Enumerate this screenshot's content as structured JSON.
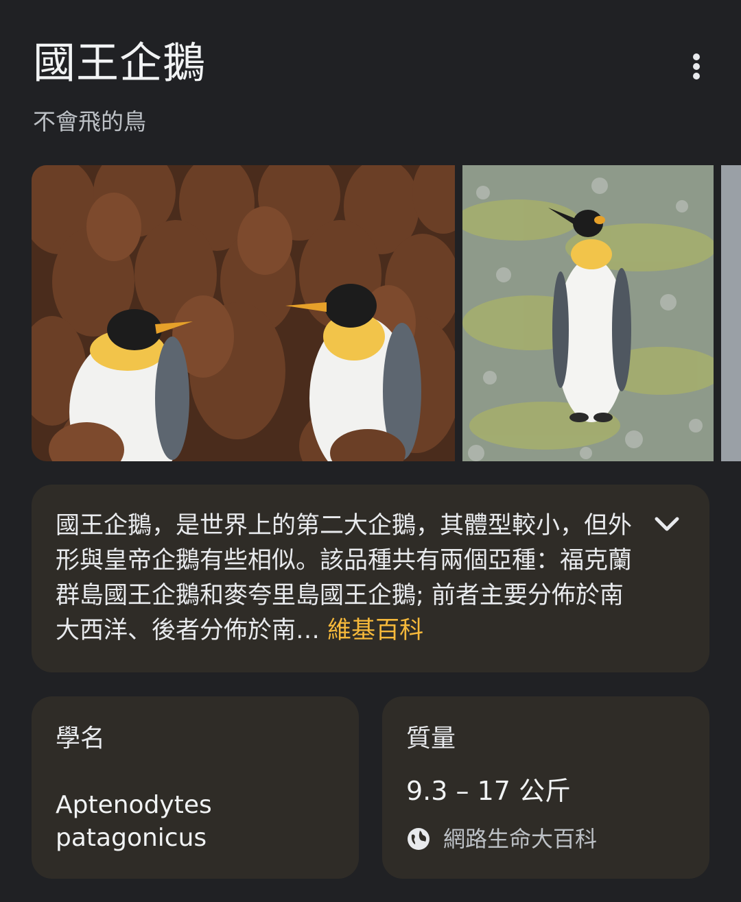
{
  "header": {
    "title": "國王企鵝",
    "subtitle": "不會飛的鳥",
    "more_icon": "more-vert-icon"
  },
  "images": [
    {
      "description": "king penguins among brown chicks"
    },
    {
      "description": "king penguin standing on rocky ground"
    },
    {
      "description": "partial third image"
    }
  ],
  "description": {
    "text": "國王企鵝，是世界上的第二大企鵝，其體型較小，但外形與皇帝企鵝有些相似。該品種共有兩個亞種：福克蘭群島國王企鵝和麥夸里島國王企鵝; 前者主要分佈於南大西洋、後者分佈於南",
    "truncation": "… ",
    "source_link": "維基百科",
    "expand_icon": "chevron-down-icon"
  },
  "facts": {
    "scientific_name": {
      "label": "學名",
      "value": "Aptenodytes patagonicus"
    },
    "mass": {
      "label": "質量",
      "value": "9.3 – 17 公斤",
      "source": "網路生命大百科",
      "source_icon": "globe-icon"
    }
  },
  "colors": {
    "background": "#202124",
    "card": "#2f2c27",
    "link": "#f6b93b"
  }
}
